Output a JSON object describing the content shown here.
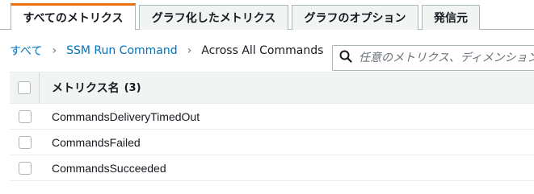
{
  "tabs": [
    {
      "label": "すべてのメトリクス",
      "active": true
    },
    {
      "label": "グラフ化したメトリクス",
      "active": false
    },
    {
      "label": "グラフのオプション",
      "active": false
    },
    {
      "label": "発信元",
      "active": false
    }
  ],
  "breadcrumb": {
    "items": [
      {
        "label": "すべて",
        "link": true
      },
      {
        "label": "SSM Run Command",
        "link": true
      },
      {
        "label": "Across All Commands",
        "link": false
      }
    ],
    "separator": "›"
  },
  "search": {
    "placeholder": "任意のメトリクス、ディメンション"
  },
  "table": {
    "header_label": "メトリクス名",
    "header_count": "(3)",
    "rows": [
      {
        "label": "CommandsDeliveryTimedOut"
      },
      {
        "label": "CommandsFailed"
      },
      {
        "label": "CommandsSucceeded"
      }
    ]
  },
  "colors": {
    "accent": "#ec7211",
    "link": "#0073bb",
    "header_bg": "#f2f3f3"
  }
}
